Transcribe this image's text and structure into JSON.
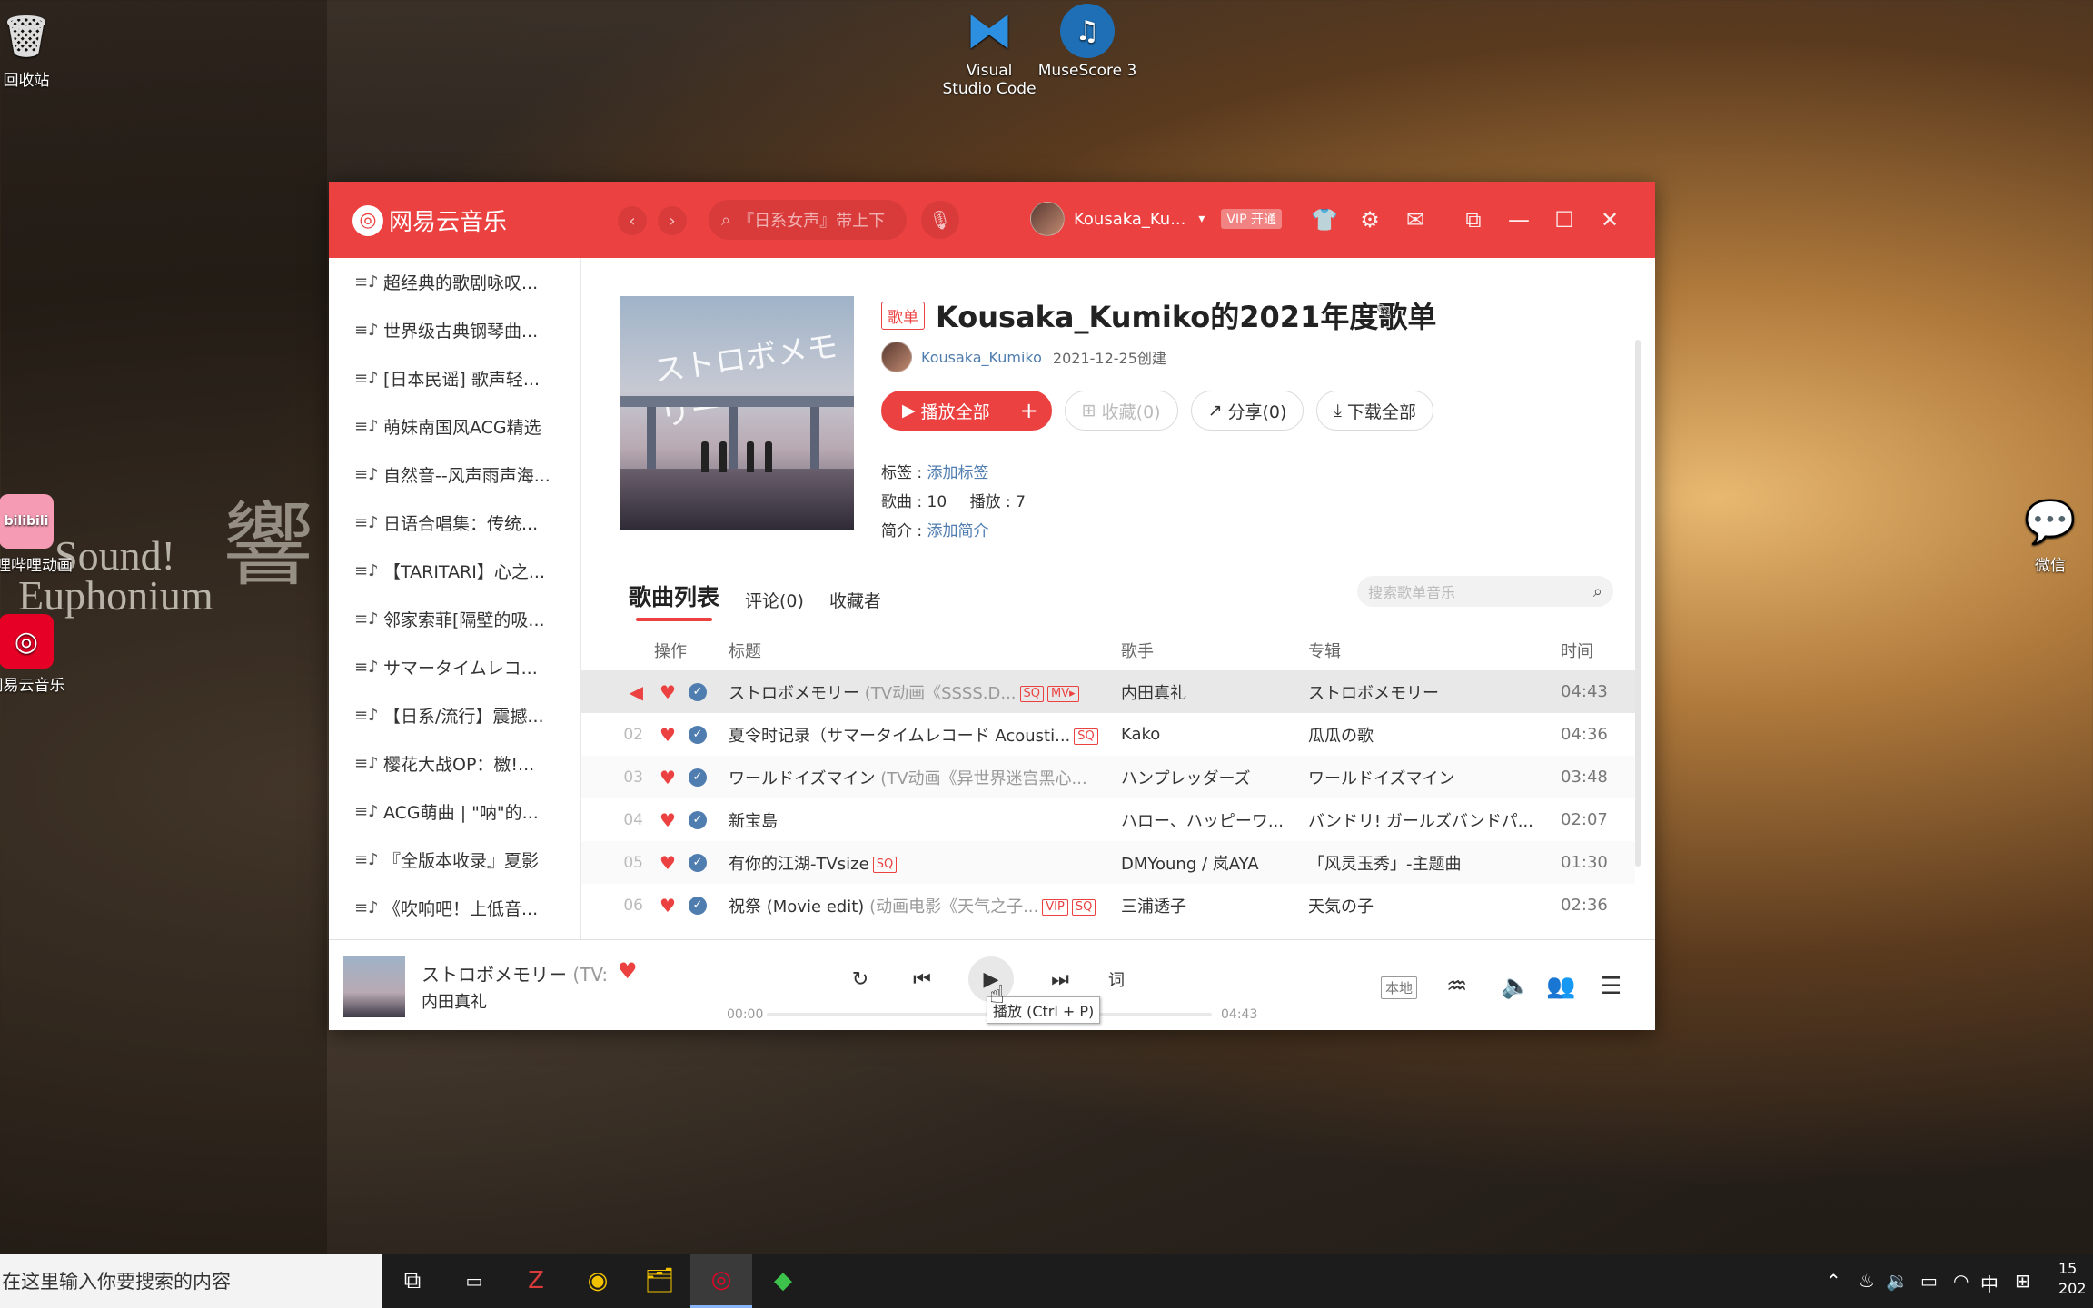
{
  "desktop": {
    "icons": [
      {
        "id": "recycle",
        "label": "回收站"
      },
      {
        "id": "vscode",
        "label": "Visual Studio Code"
      },
      {
        "id": "musescore",
        "label": "MuseScore 3"
      },
      {
        "id": "bilibili",
        "label": "哔哩哔哩动画",
        "glyph": "bilibili"
      },
      {
        "id": "netease",
        "label": "网易云音乐"
      },
      {
        "id": "wechat",
        "label": "微信"
      }
    ],
    "wallpaper_text": {
      "line1": "Sound!",
      "line2": "Euphonium",
      "big": "響"
    }
  },
  "app": {
    "brand": "网易云音乐",
    "search_placeholder": "『日系女声』带上下",
    "user": {
      "name": "Kousaka_Ku...",
      "vip": "VIP 开通"
    },
    "sidebar": [
      "超经典的歌剧咏叹...",
      "世界级古典钢琴曲...",
      "[日本民谣] 歌声轻...",
      "萌妹南国风ACG精选",
      "自然音--风声雨声海...",
      "日语合唱集：传统...",
      "【TARITARI】心之...",
      "邻家索菲[隔壁的吸...",
      "サマータイムレコ...",
      "【日系/流行】震撼...",
      "樱花大战OP：檄!...",
      "ACG萌曲 | \"呐\"的...",
      "『全版本收录』夏影",
      "《吹响吧！上低音..."
    ],
    "playlist": {
      "tag": "歌单",
      "title": "Kousaka_Kumiko的2021年度歌单",
      "creator": "Kousaka_Kumiko",
      "created": "2021-12-25创建",
      "buttons": {
        "play_all": "播放全部",
        "collect": "收藏(0)",
        "share": "分享(0)",
        "download": "下载全部"
      },
      "meta": {
        "tags_label": "标签 : ",
        "tags_link": "添加标签",
        "songs_label": "歌曲 : 10",
        "plays_label": "播放 : 7",
        "intro_label": "简介 : ",
        "intro_link": "添加简介"
      },
      "cover_text": "ストロボメモリー"
    },
    "tabs": [
      {
        "label": "歌曲列表",
        "active": true
      },
      {
        "label": "评论(0)",
        "active": false
      },
      {
        "label": "收藏者",
        "active": false
      }
    ],
    "inner_search_placeholder": "搜索歌单音乐",
    "columns": {
      "op": "操作",
      "title": "标题",
      "artist": "歌手",
      "album": "专辑",
      "time": "时间"
    },
    "songs": [
      {
        "num": "",
        "title": "ストロボメモリー",
        "sub": "(TV动画《SSSS.D...",
        "badges": [
          "SQ",
          "MV▸"
        ],
        "artist": "内田真礼",
        "album": "ストロボメモリー",
        "time": "04:43"
      },
      {
        "num": "02",
        "title": "夏令时记录（サマータイムレコード Acousti...",
        "sub": "",
        "badges": [
          "SQ"
        ],
        "artist": "Kako",
        "album": "瓜瓜の歌",
        "time": "04:36"
      },
      {
        "num": "03",
        "title": "ワールドイズマイン",
        "sub": "(TV动画《异世界迷宫黑心...",
        "badges": [],
        "artist": "ハンプレッダーズ",
        "album": "ワールドイズマイン",
        "time": "03:48"
      },
      {
        "num": "04",
        "title": "新宝島",
        "sub": "",
        "badges": [],
        "artist": "ハロー、ハッピーワ...",
        "album": "バンドリ! ガールズバンドパ...",
        "time": "02:07"
      },
      {
        "num": "05",
        "title": "有你的江湖-TVsize",
        "sub": "",
        "badges": [
          "SQ"
        ],
        "artist": "DMYoung / 岚AYA",
        "album": "「风灵玉秀」-主题曲",
        "time": "01:30"
      },
      {
        "num": "06",
        "title": "祝祭 (Movie edit)",
        "sub": "(动画电影《天气之子...",
        "badges": [
          "VIP",
          "SQ"
        ],
        "artist": "三浦透子",
        "album": "天気の子",
        "time": "02:36"
      }
    ],
    "player": {
      "title": "ストロボメモリー",
      "sub": "(TV:",
      "artist": "内田真礼",
      "lyrics_btn": "词",
      "elapsed": "00:00",
      "duration": "04:43",
      "progress": 0,
      "tooltip": "播放 (Ctrl + P)",
      "local_btn": "本地"
    }
  },
  "taskbar": {
    "search_placeholder": "在这里输入你要搜索的内容",
    "ime": "中",
    "clock_top": "15",
    "clock_bottom": "202"
  },
  "colors": {
    "accent": "#ec4141",
    "link": "#507daf"
  }
}
